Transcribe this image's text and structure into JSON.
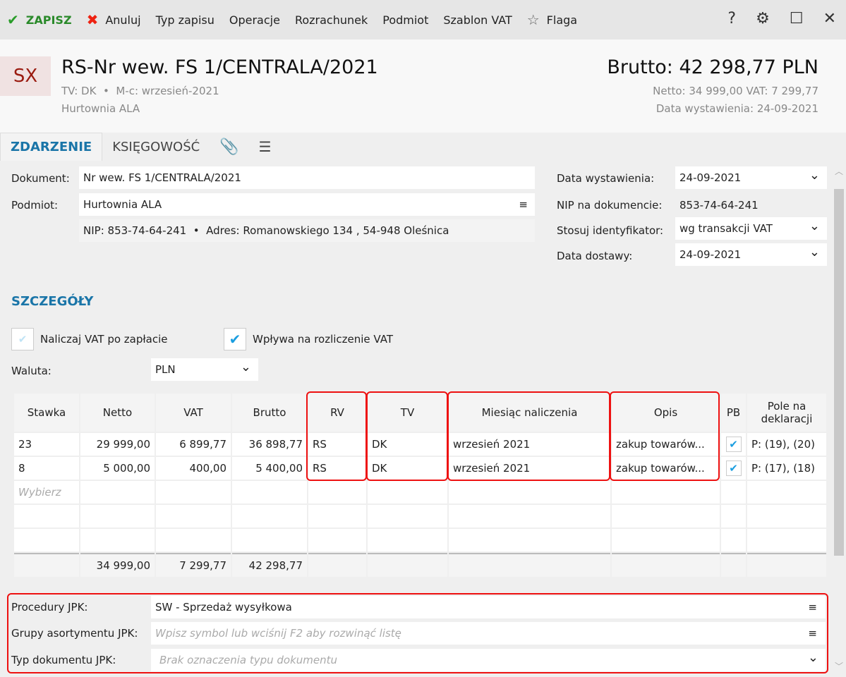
{
  "toolbar": {
    "save": "ZAPISZ",
    "cancel": "Anuluj",
    "items": [
      "Typ zapisu",
      "Operacje",
      "Rozrachunek",
      "Podmiot",
      "Szablon VAT"
    ],
    "flag": "Flaga"
  },
  "header": {
    "badge": "SX",
    "title": "RS-Nr wew. FS 1/CENTRALA/2021",
    "tv": "TV: DK",
    "month": "M-c: wrzesień-2021",
    "entity": "Hurtownia ALA",
    "brutto": "Brutto: 42 298,77 PLN",
    "netto_vat": "Netto: 34 999,00 VAT: 7 299,77",
    "issue_date": "Data wystawienia: 24-09-2021"
  },
  "tabs": [
    "ZDARZENIE",
    "KSIĘGOWOŚĆ"
  ],
  "form": {
    "doc_label": "Dokument:",
    "doc_value": "Nr wew. FS 1/CENTRALA/2021",
    "subject_label": "Podmiot:",
    "subject_value": "Hurtownia ALA",
    "nip_label": "NIP:",
    "nip_value": "853-74-64-241",
    "addr_label": "Adres:",
    "addr_value": "Romanowskiego 134 , 54-948 Oleśnica",
    "issue_label": "Data wystawienia:",
    "issue_value": "24-09-2021",
    "nipdoc_label": "NIP na dokumencie:",
    "nipdoc_value": "853-74-64-241",
    "ident_label": "Stosuj identyfikator:",
    "ident_value": "wg transakcji VAT",
    "delivery_label": "Data dostawy:",
    "delivery_value": "24-09-2021"
  },
  "details": {
    "title": "SZCZEGÓŁY",
    "vat_after_payment": "Naliczaj VAT po zapłacie",
    "affects_vat": "Wpływa na rozliczenie VAT",
    "currency_label": "Waluta:",
    "currency_value": "PLN"
  },
  "table": {
    "headers": [
      "Stawka",
      "Netto",
      "VAT",
      "Brutto",
      "RV",
      "TV",
      "Miesiąc naliczenia",
      "Opis",
      "PB",
      "Pole na deklaracji"
    ],
    "rows": [
      [
        "23",
        "29 999,00",
        "6 899,77",
        "36 898,77",
        "RS",
        "DK",
        "wrzesień 2021",
        "zakup towarów...",
        "",
        "P: (19), (20)"
      ],
      [
        "8",
        "5 000,00",
        "400,00",
        "5 400,00",
        "RS",
        "DK",
        "wrzesień 2021",
        "zakup towarów...",
        "",
        "P: (17), (18)"
      ]
    ],
    "placeholder": "Wybierz",
    "totals": [
      "34 999,00",
      "7 299,77",
      "42 298,77"
    ]
  },
  "jpk": {
    "proc_label": "Procedury JPK:",
    "proc_value": "SW - Sprzedaż wysyłkowa",
    "groups_label": "Grupy asortymentu JPK:",
    "groups_placeholder": "Wpisz symbol lub wciśnij F2 aby rozwinąć listę",
    "type_label": "Typ dokumentu JPK:",
    "type_placeholder": "Brak oznaczenia typu dokumentu"
  }
}
